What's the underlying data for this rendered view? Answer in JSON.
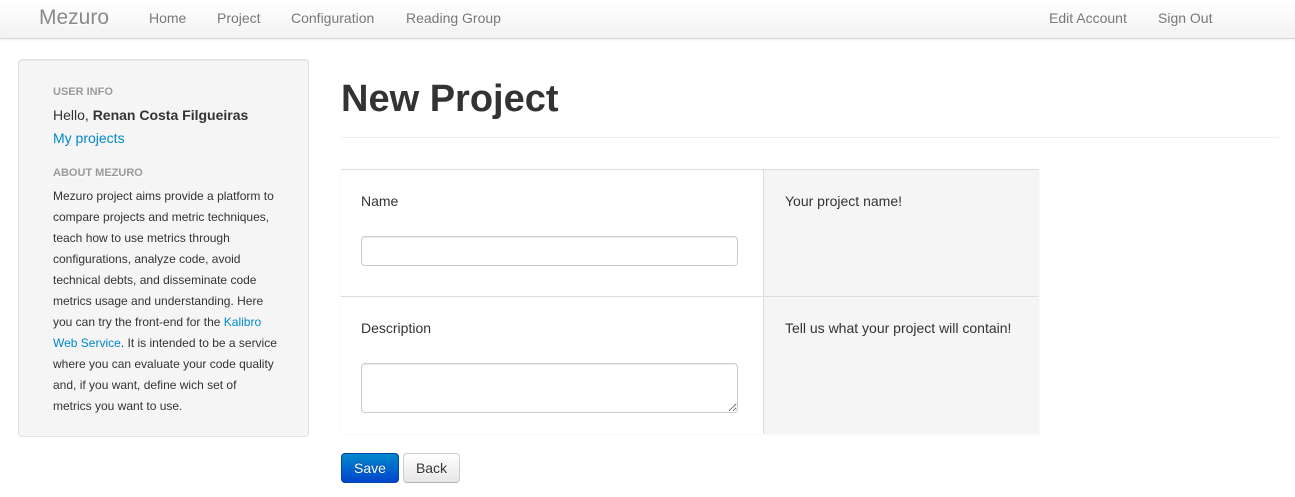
{
  "navbar": {
    "brand": "Mezuro",
    "items": [
      "Home",
      "Project",
      "Configuration",
      "Reading Group"
    ],
    "right_items": [
      "Edit Account",
      "Sign Out"
    ]
  },
  "sidebar": {
    "user_info_header": "USER INFO",
    "hello_prefix": "Hello, ",
    "user_name": "Renan Costa Filgueiras",
    "my_projects": "My projects",
    "about_header": "ABOUT MEZURO",
    "about_before_link": "Mezuro project aims provide a platform to compare projects and metric techniques, teach how to use metrics through configurations, analyze code, avoid technical debts, and disseminate code metrics usage and understanding. Here you can try the front-end for the ",
    "about_link": "Kalibro Web Service",
    "about_after_link": ". It is intended to be a service where you can evaluate your code quality and, if you want, define wich set of metrics you want to use."
  },
  "main": {
    "title": "New Project",
    "form": {
      "name_label": "Name",
      "name_value": "",
      "name_hint": "Your project name!",
      "description_label": "Description",
      "description_value": "",
      "description_hint": "Tell us what your project will contain!"
    },
    "buttons": {
      "save": "Save",
      "back": "Back"
    }
  },
  "colors": {
    "link": "#0088cc",
    "primary_button": "#0055cc",
    "sidebar_bg": "#f5f5f5"
  }
}
